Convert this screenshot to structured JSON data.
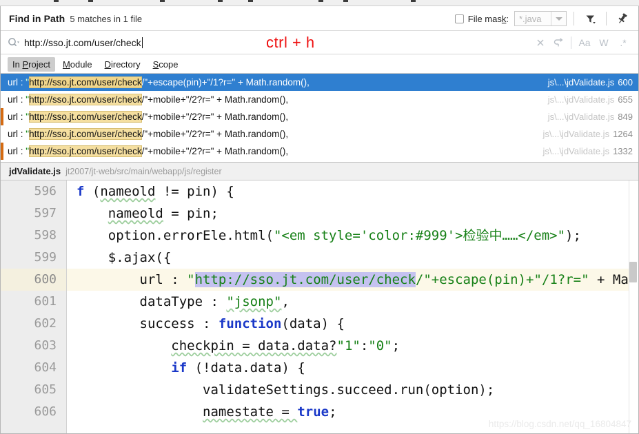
{
  "dialog": {
    "title": "Find in Path",
    "matches_summary": "5 matches in 1 file"
  },
  "header": {
    "file_mask_label_pre": "File mas",
    "file_mask_label_key": "k",
    "file_mask_label_post": ":",
    "file_mask_checked": false,
    "file_mask_value": "*.java",
    "filter_icon": "filter-icon",
    "pin_icon": "pin-icon"
  },
  "search": {
    "value": "http://sso.jt.com/user/check",
    "icon": "search-icon",
    "annotation": "ctrl + h",
    "annotation_color": "#ee1111",
    "clear_icon": "close-icon",
    "history_icon": "history-icon",
    "match_case_label": "Aa",
    "whole_words_label": "W",
    "regex_label": ".*"
  },
  "scope": {
    "tabs": [
      {
        "pre": "In ",
        "key": "P",
        "post": "roject",
        "active": true
      },
      {
        "pre": "",
        "key": "M",
        "post": "odule",
        "active": false
      },
      {
        "pre": "",
        "key": "D",
        "post": "irectory",
        "active": false
      },
      {
        "pre": "",
        "key": "S",
        "post": "cope",
        "active": false
      }
    ]
  },
  "results": {
    "rows": [
      {
        "label": "url : ",
        "quote_open": "\"",
        "match": "http://sso.jt.com/user/check",
        "rest": "/\"+escape(pin)+\"/1?r=\" + Math.random(),",
        "file": "js\\...\\jdValidate.js",
        "line": "600",
        "selected": true
      },
      {
        "label": "url : ",
        "quote_open": "\"",
        "match": "http://sso.jt.com/user/check",
        "rest": "/\"+mobile+\"/2?r=\" + Math.random(),",
        "file": "js\\...\\jdValidate.js",
        "line": "655",
        "selected": false
      },
      {
        "label": "url : ",
        "quote_open": "\"",
        "match": "http://sso.jt.com/user/check",
        "rest": "/\"+mobile+\"/2?r=\" + Math.random(),",
        "file": "js\\...\\jdValidate.js",
        "line": "849",
        "selected": false
      },
      {
        "label": "url : ",
        "quote_open": "\"",
        "match": "http://sso.jt.com/user/check",
        "rest": "/\"+mobile+\"/2?r=\" + Math.random(),",
        "file": "js\\...\\jdValidate.js",
        "line": "1264",
        "selected": false
      },
      {
        "label": "url : ",
        "quote_open": "\"",
        "match": "http://sso.jt.com/user/check",
        "rest": "/\"+mobile+\"/2?r=\" + Math.random(),",
        "file": "js\\...\\jdValidate.js",
        "line": "1332",
        "selected": false
      }
    ]
  },
  "preview": {
    "file_name": "jdValidate.js",
    "file_path": "jt2007/jt-web/src/main/webapp/js/register",
    "lines": [
      {
        "num": "596",
        "highlight": false
      },
      {
        "num": "597",
        "highlight": false
      },
      {
        "num": "598",
        "highlight": false
      },
      {
        "num": "599",
        "highlight": false
      },
      {
        "num": "600",
        "highlight": true
      },
      {
        "num": "601",
        "highlight": false
      },
      {
        "num": "602",
        "highlight": false
      },
      {
        "num": "603",
        "highlight": false
      },
      {
        "num": "604",
        "highlight": false
      },
      {
        "num": "605",
        "highlight": false
      },
      {
        "num": "606",
        "highlight": false
      }
    ],
    "code": {
      "l596": "f (nameold != pin) {",
      "l597": "nameold = pin;",
      "l598_a": "option.errorEle.html(",
      "l598_str": "\"<em style='color:#999'>检验中……</em>\"",
      "l598_b": ");",
      "l599": "$.ajax({",
      "l600_a": "url : ",
      "l600_quote": "\"",
      "l600_sel": "http://sso.jt.com/user/check",
      "l600_b": "/\"+escape(pin)+\"/1?r=\"",
      "l600_c": " + Ma",
      "l601_a": "dataType : ",
      "l601_str": "\"jsonp\"",
      "l601_b": ",",
      "l602_a": "success : ",
      "l602_kw": "function",
      "l602_b": "(data) {",
      "l603_a": "checkpin = data.data?",
      "l603_s1": "\"1\"",
      "l603_colon": ":",
      "l603_s2": "\"0\"",
      "l603_b": ";",
      "l604_kw": "if",
      "l604_b": " (!data.data) {",
      "l605": "validateSettings.succeed.run(option);",
      "l606_a": "namestate = ",
      "l606_kw": "true",
      "l606_b": ";"
    }
  },
  "watermark": "https://blog.csdn.net/qq_16804847"
}
